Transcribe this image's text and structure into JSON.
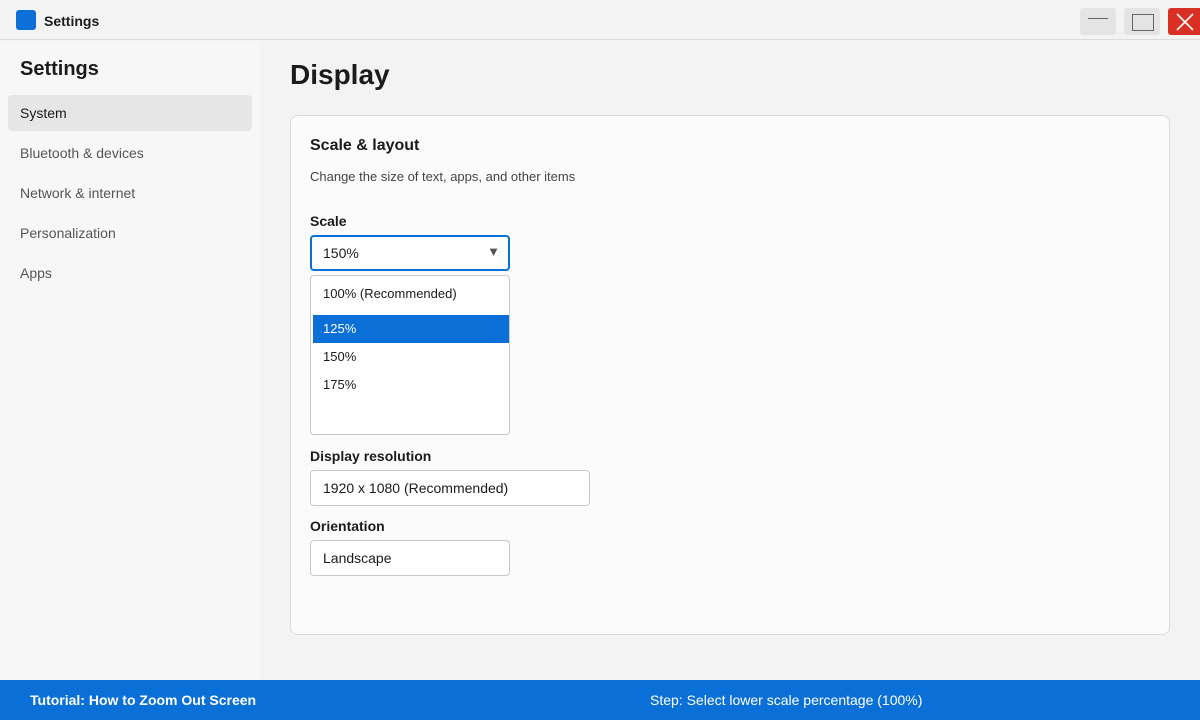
{
  "window": {
    "title": "Settings",
    "minimize_icon": "minimize-icon",
    "maximize_icon": "maximize-icon",
    "close_icon": "close-icon",
    "close_color": "#d93025",
    "accent_color": "#0a6fd6"
  },
  "sidebar": {
    "title": "Settings",
    "items": [
      {
        "label": "System",
        "active": true
      },
      {
        "label": "Bluetooth & devices",
        "active": false
      },
      {
        "label": "Network & internet",
        "active": false
      },
      {
        "label": "Personalization",
        "active": false
      },
      {
        "label": "Apps",
        "active": false
      }
    ]
  },
  "main": {
    "title": "Display",
    "card": {
      "title": "Scale & layout",
      "description": "Change the size of text, apps, and other items",
      "scale": {
        "label": "Scale",
        "value": "150%",
        "options": [
          "100% (Recommended)",
          "125%",
          "150%",
          "175%"
        ],
        "highlighted": "125%"
      },
      "resolution": {
        "label": "Display resolution",
        "value": "1920 x 1080 (Recommended)"
      },
      "orientation": {
        "label": "Orientation",
        "value": "Landscape"
      }
    }
  },
  "footer": {
    "tutorial": "Tutorial: How to Zoom Out Screen",
    "step": "Step: Select lower scale percentage (100%)"
  }
}
